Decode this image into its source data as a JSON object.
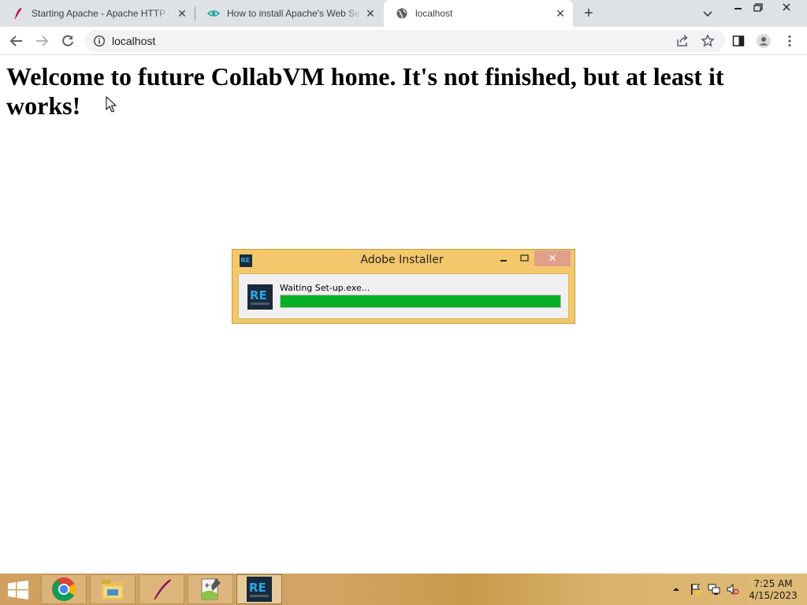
{
  "browser": {
    "tabs": [
      {
        "title": "Starting Apache - Apache HTTP Server",
        "favicon": "apache-feather-icon"
      },
      {
        "title": "How to install Apache's Web Server",
        "favicon": "eye-icon"
      },
      {
        "title": "localhost",
        "favicon": "globe-icon",
        "active": true
      }
    ],
    "address": "localhost",
    "colors": {
      "tabstrip": "#dee1e6",
      "omnibox": "#f1f3f4"
    }
  },
  "page": {
    "heading": "Welcome to future CollabVM home. It's not finished, but at least it works!"
  },
  "dialog": {
    "title": "Adobe Installer",
    "app_icon": "repack-logo-icon",
    "status_text": "Waiting Set-up.exe...",
    "progress_percent": 100,
    "colors": {
      "frame": "#f3c86a",
      "progress": "#06b025"
    }
  },
  "taskbar": {
    "apps": [
      {
        "name": "chrome",
        "icon": "chrome-icon"
      },
      {
        "name": "file-explorer",
        "icon": "folder-icon"
      },
      {
        "name": "apache",
        "icon": "apache-feather-icon"
      },
      {
        "name": "notepad++",
        "icon": "notepad-plus-plus-icon"
      },
      {
        "name": "installer",
        "icon": "repack-logo-icon",
        "active": true
      }
    ],
    "clock": {
      "time": "7:25 AM",
      "date": "4/15/2023"
    }
  }
}
